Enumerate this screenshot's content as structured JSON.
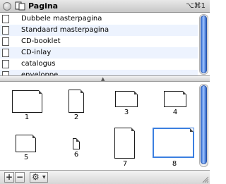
{
  "window": {
    "title": "Pagina",
    "shortcut": "⌥⌘1"
  },
  "masters": [
    {
      "label": "Dubbele masterpagina"
    },
    {
      "label": "Standaard masterpagina"
    },
    {
      "label": "CD-booklet"
    },
    {
      "label": "CD-inlay"
    },
    {
      "label": "catalogus"
    },
    {
      "label": "enveloppe"
    }
  ],
  "pages": [
    {
      "number": "1",
      "orientation": "landscape",
      "selected": false
    },
    {
      "number": "2",
      "orientation": "portrait",
      "selected": false
    },
    {
      "number": "3",
      "orientation": "landscape",
      "selected": false
    },
    {
      "number": "4",
      "orientation": "landscape",
      "selected": false
    },
    {
      "number": "5",
      "orientation": "landscape",
      "selected": false
    },
    {
      "number": "6",
      "orientation": "portrait",
      "selected": false
    },
    {
      "number": "7",
      "orientation": "portrait",
      "selected": false
    },
    {
      "number": "8",
      "orientation": "landscape",
      "selected": true
    }
  ],
  "toolbar": {
    "add_label": "+",
    "remove_label": "−",
    "gear_label": "⚙",
    "menu_caret": "▼"
  },
  "splitter": {
    "label": "▲"
  },
  "colors": {
    "selection": "#3b7fe0",
    "scroll_thumb": "#3a74d6",
    "row_alt": "#edf3fe"
  }
}
